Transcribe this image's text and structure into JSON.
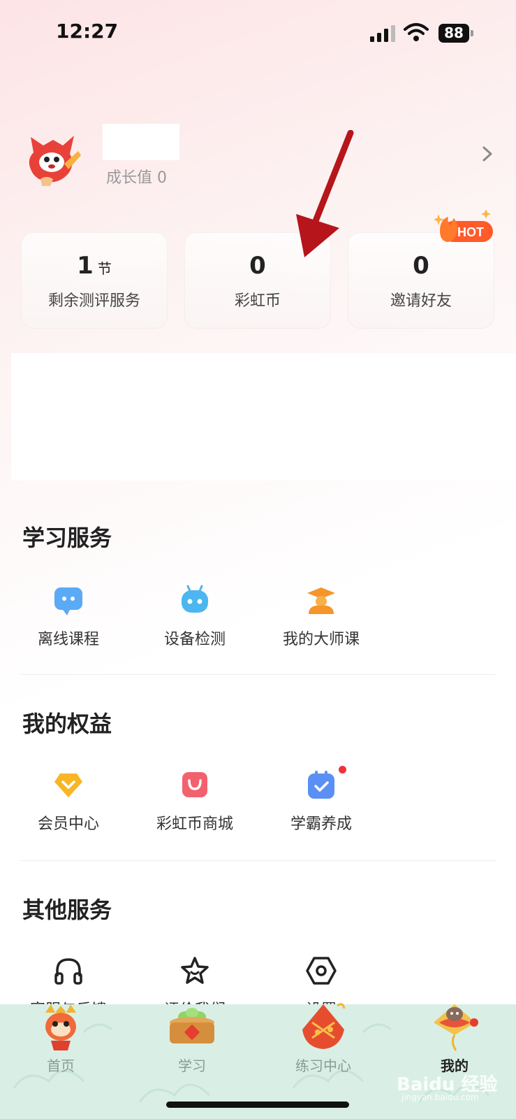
{
  "status_bar": {
    "time": "12:27",
    "battery": "88"
  },
  "profile": {
    "growth_label": "成长值",
    "growth_value": "0"
  },
  "stats": [
    {
      "value": "1",
      "unit": "节",
      "label": "剩余测评服务"
    },
    {
      "value": "0",
      "unit": "",
      "label": "彩虹币"
    },
    {
      "value": "0",
      "unit": "",
      "label": "邀请好友"
    }
  ],
  "hot_badge": "HOT",
  "sections": {
    "study": {
      "title": "学习服务",
      "items": [
        {
          "label": "离线课程",
          "icon": "chat-bubble-icon"
        },
        {
          "label": "设备检测",
          "icon": "robot-icon"
        },
        {
          "label": "我的大师课",
          "icon": "graduation-cap-icon"
        }
      ]
    },
    "benefits": {
      "title": "我的权益",
      "items": [
        {
          "label": "会员中心",
          "icon": "diamond-icon"
        },
        {
          "label": "彩虹币商城",
          "icon": "shopping-bag-icon"
        },
        {
          "label": "学霸养成",
          "icon": "calendar-check-icon"
        }
      ]
    },
    "other": {
      "title": "其他服务",
      "items": [
        {
          "label": "客服与反馈",
          "icon": "headphones-icon"
        },
        {
          "label": "评价我们",
          "icon": "star-icon"
        },
        {
          "label": "设置",
          "icon": "settings-hex-icon"
        }
      ]
    }
  },
  "tabbar": [
    {
      "label": "首页",
      "icon": "dragon-head-icon",
      "active": false
    },
    {
      "label": "学习",
      "icon": "dumpling-steamer-icon",
      "active": false
    },
    {
      "label": "练习中心",
      "icon": "zongzi-icon",
      "active": false
    },
    {
      "label": "我的",
      "icon": "kite-icon",
      "active": true
    }
  ],
  "watermark": {
    "text": "Baidu 经验",
    "sub": "jingyan.baidu.com"
  },
  "colors": {
    "accent_red": "#f0323c",
    "tabbar_bg": "#d9efe6",
    "hot_orange": "#ff5a2a"
  }
}
